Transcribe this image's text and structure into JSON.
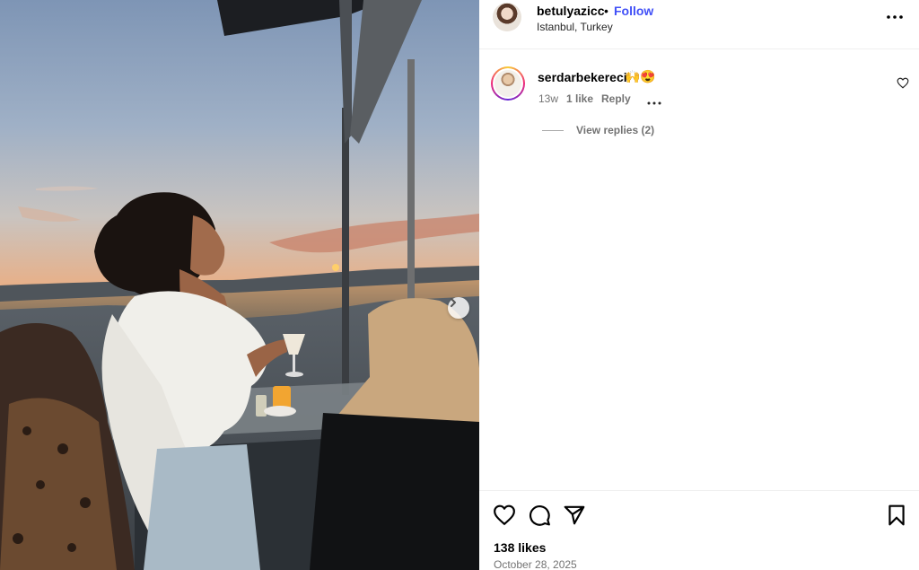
{
  "post": {
    "username": "betulyazicc",
    "separator": "•",
    "follow_label": "Follow",
    "location": "Istanbul, Turkey"
  },
  "comment": {
    "username": "serdarbekereci",
    "emojis": "🙌😍",
    "time": "13w",
    "likes": "1 like",
    "reply_label": "Reply",
    "view_replies": "View replies (2)"
  },
  "footer": {
    "likes_count": "138 likes",
    "date": "October 28, 2025"
  },
  "icons": {
    "more": "more-horizontal-icon",
    "heart": "heart-icon",
    "comment": "comment-icon",
    "share": "share-icon",
    "save": "bookmark-icon",
    "next": "chevron-right-icon"
  },
  "colors": {
    "follow": "#4150f7",
    "secondary_text": "#737373",
    "divider": "#efefef"
  }
}
